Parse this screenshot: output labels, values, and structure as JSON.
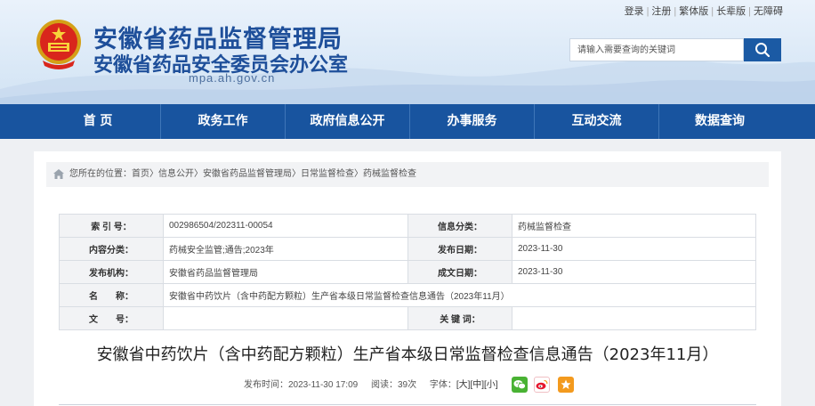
{
  "header": {
    "title": "安徽省药品监督管理局",
    "subtitle": "安徽省药品安全委员会办公室",
    "domain": "mpa.ah.gov.cn",
    "toplinks": [
      "登录",
      "注册",
      "繁体版",
      "长辈版",
      "无障碍"
    ],
    "search_placeholder": "请输入需要查询的关键词"
  },
  "nav": {
    "items": [
      "首 页",
      "政务工作",
      "政府信息公开",
      "办事服务",
      "互动交流",
      "数据查询"
    ]
  },
  "breadcrumb": {
    "prefix": "您所在的位置：",
    "items": [
      "首页",
      "信息公开",
      "安徽省药品监督管理局",
      "日常监督检查",
      "药械监督检查"
    ],
    "separator": "〉"
  },
  "meta": {
    "index_label": "索 引 号：",
    "index_value": "002986504/202311-00054",
    "info_category_label": "信息分类：",
    "info_category_value": "药械监督检查",
    "content_category_label": "内容分类：",
    "content_category_value": "药械安全监管;通告;2023年",
    "publish_date_label": "发布日期：",
    "publish_date_value": "2023-11-30",
    "publisher_label": "发布机构：",
    "publisher_value": "安徽省药品监督管理局",
    "created_date_label": "成文日期：",
    "created_date_value": "2023-11-30",
    "name_label": "名　　称：",
    "name_value": "安徽省中药饮片（含中药配方颗粒）生产省本级日常监督检查信息通告（2023年11月）",
    "docno_label": "文　　号：",
    "docno_value": "",
    "keywords_label": "关 键 词：",
    "keywords_value": ""
  },
  "article": {
    "title": "安徽省中药饮片（含中药配方颗粒）生产省本级日常监督检查信息通告（2023年11月）",
    "publish_time": "发布时间：2023-11-30 17:09",
    "reads": "阅读：39次",
    "font_label": "字体：",
    "font_large": "[大]",
    "font_medium": "[中]",
    "font_small": "[小]",
    "share_icons": [
      "wechat-icon",
      "weibo-icon",
      "favorite-icon"
    ]
  },
  "colors": {
    "brand_blue": "#18549f",
    "title_blue": "#1e4f9a",
    "wechat_green": "#49b233",
    "weibo_red": "#e6162d",
    "favorite_orange": "#f39a1e"
  }
}
